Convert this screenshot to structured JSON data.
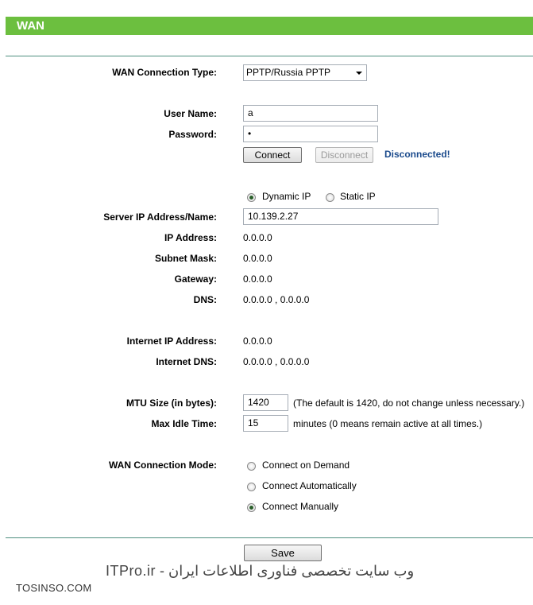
{
  "header": {
    "title": "WAN"
  },
  "connection_type": {
    "label": "WAN Connection Type:",
    "value": "PPTP/Russia PPTP"
  },
  "credentials": {
    "username_label": "User Name:",
    "username_value": "a",
    "password_label": "Password:",
    "password_value": "•"
  },
  "actions": {
    "connect_label": "Connect",
    "disconnect_label": "Disconnect",
    "status": "Disconnected!"
  },
  "ip_mode": {
    "dynamic_label": "Dynamic IP",
    "static_label": "Static IP",
    "selected": "dynamic"
  },
  "server": {
    "label": "Server IP Address/Name:",
    "value": "10.139.2.27"
  },
  "info": {
    "ip_label": "IP Address:",
    "ip_value": "0.0.0.0",
    "mask_label": "Subnet Mask:",
    "mask_value": "0.0.0.0",
    "gateway_label": "Gateway:",
    "gateway_value": "0.0.0.0",
    "dns_label": "DNS:",
    "dns_value": "0.0.0.0 , 0.0.0.0"
  },
  "internet": {
    "ip_label": "Internet IP Address:",
    "ip_value": "0.0.0.0",
    "dns_label": "Internet DNS:",
    "dns_value": "0.0.0.0 , 0.0.0.0"
  },
  "mtu": {
    "label": "MTU Size (in bytes):",
    "value": "1420",
    "hint": "(The default is 1420, do not change unless necessary.)"
  },
  "idle": {
    "label": "Max Idle Time:",
    "value": "15",
    "hint": "minutes (0 means remain active at all times.)"
  },
  "mode": {
    "label": "WAN Connection Mode:",
    "options": [
      "Connect on Demand",
      "Connect Automatically",
      "Connect Manually"
    ],
    "selected": "Connect Manually"
  },
  "footer": {
    "save_label": "Save"
  },
  "watermark": {
    "persian": "وب سایت تخصصی فناوری اطلاعات ایران - ITPro.ir",
    "site": "TOSINSO.COM"
  },
  "colors": {
    "header_bg": "#6cbf3f",
    "status_text": "#1a4a8c",
    "rule": "#4f8f7f"
  }
}
